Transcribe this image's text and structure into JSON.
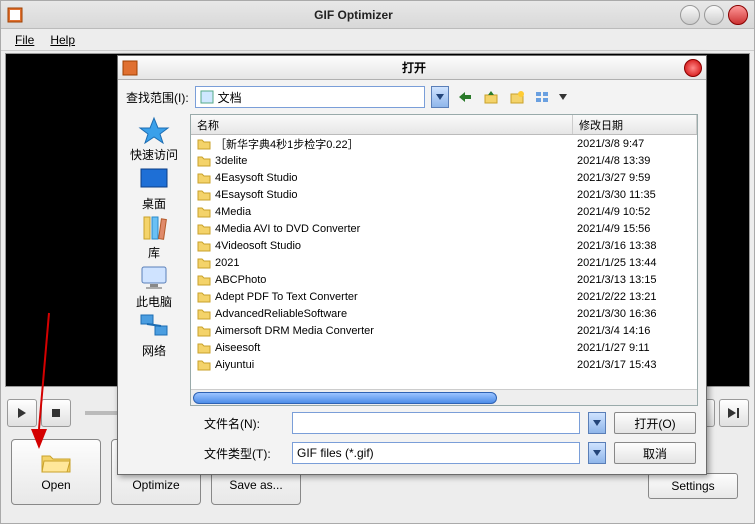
{
  "app": {
    "title": "GIF Optimizer"
  },
  "menu": {
    "file": "File",
    "help": "Help"
  },
  "main_buttons": {
    "open": "Open",
    "optimize": "Optimize",
    "saveas": "Save as...",
    "settings": "Settings"
  },
  "dialog": {
    "title": "打开",
    "look_in_label": "查找范围(I):",
    "look_in_value": "文档",
    "columns": {
      "name": "名称",
      "date": "修改日期"
    },
    "places": {
      "quick": "快速访问",
      "desktop": "桌面",
      "libraries": "库",
      "thispc": "此电脑",
      "network": "网络"
    },
    "rows": [
      {
        "name": "［新华字典4秒1步检字0.22］",
        "date": "2021/3/8 9:47"
      },
      {
        "name": "3delite",
        "date": "2021/4/8 13:39"
      },
      {
        "name": "4Easysoft Studio",
        "date": "2021/3/27 9:59"
      },
      {
        "name": "4Esaysoft Studio",
        "date": "2021/3/30 11:35"
      },
      {
        "name": "4Media",
        "date": "2021/4/9 10:52"
      },
      {
        "name": "4Media AVI to DVD Converter",
        "date": "2021/4/9 15:56"
      },
      {
        "name": "4Videosoft Studio",
        "date": "2021/3/16 13:38"
      },
      {
        "name": "2021",
        "date": "2021/1/25 13:44"
      },
      {
        "name": "ABCPhoto",
        "date": "2021/3/13 13:15"
      },
      {
        "name": "Adept PDF To Text Converter",
        "date": "2021/2/22 13:21"
      },
      {
        "name": "AdvancedReliableSoftware",
        "date": "2021/3/30 16:36"
      },
      {
        "name": "Aimersoft DRM Media Converter",
        "date": "2021/3/4 14:16"
      },
      {
        "name": "Aiseesoft",
        "date": "2021/1/27 9:11"
      },
      {
        "name": "Aiyuntui",
        "date": "2021/3/17 15:43"
      }
    ],
    "filename_label": "文件名(N):",
    "filename_value": "",
    "filetype_label": "文件类型(T):",
    "filetype_value": "GIF files (*.gif)",
    "open_btn": "打开(O)",
    "cancel_btn": "取消"
  }
}
